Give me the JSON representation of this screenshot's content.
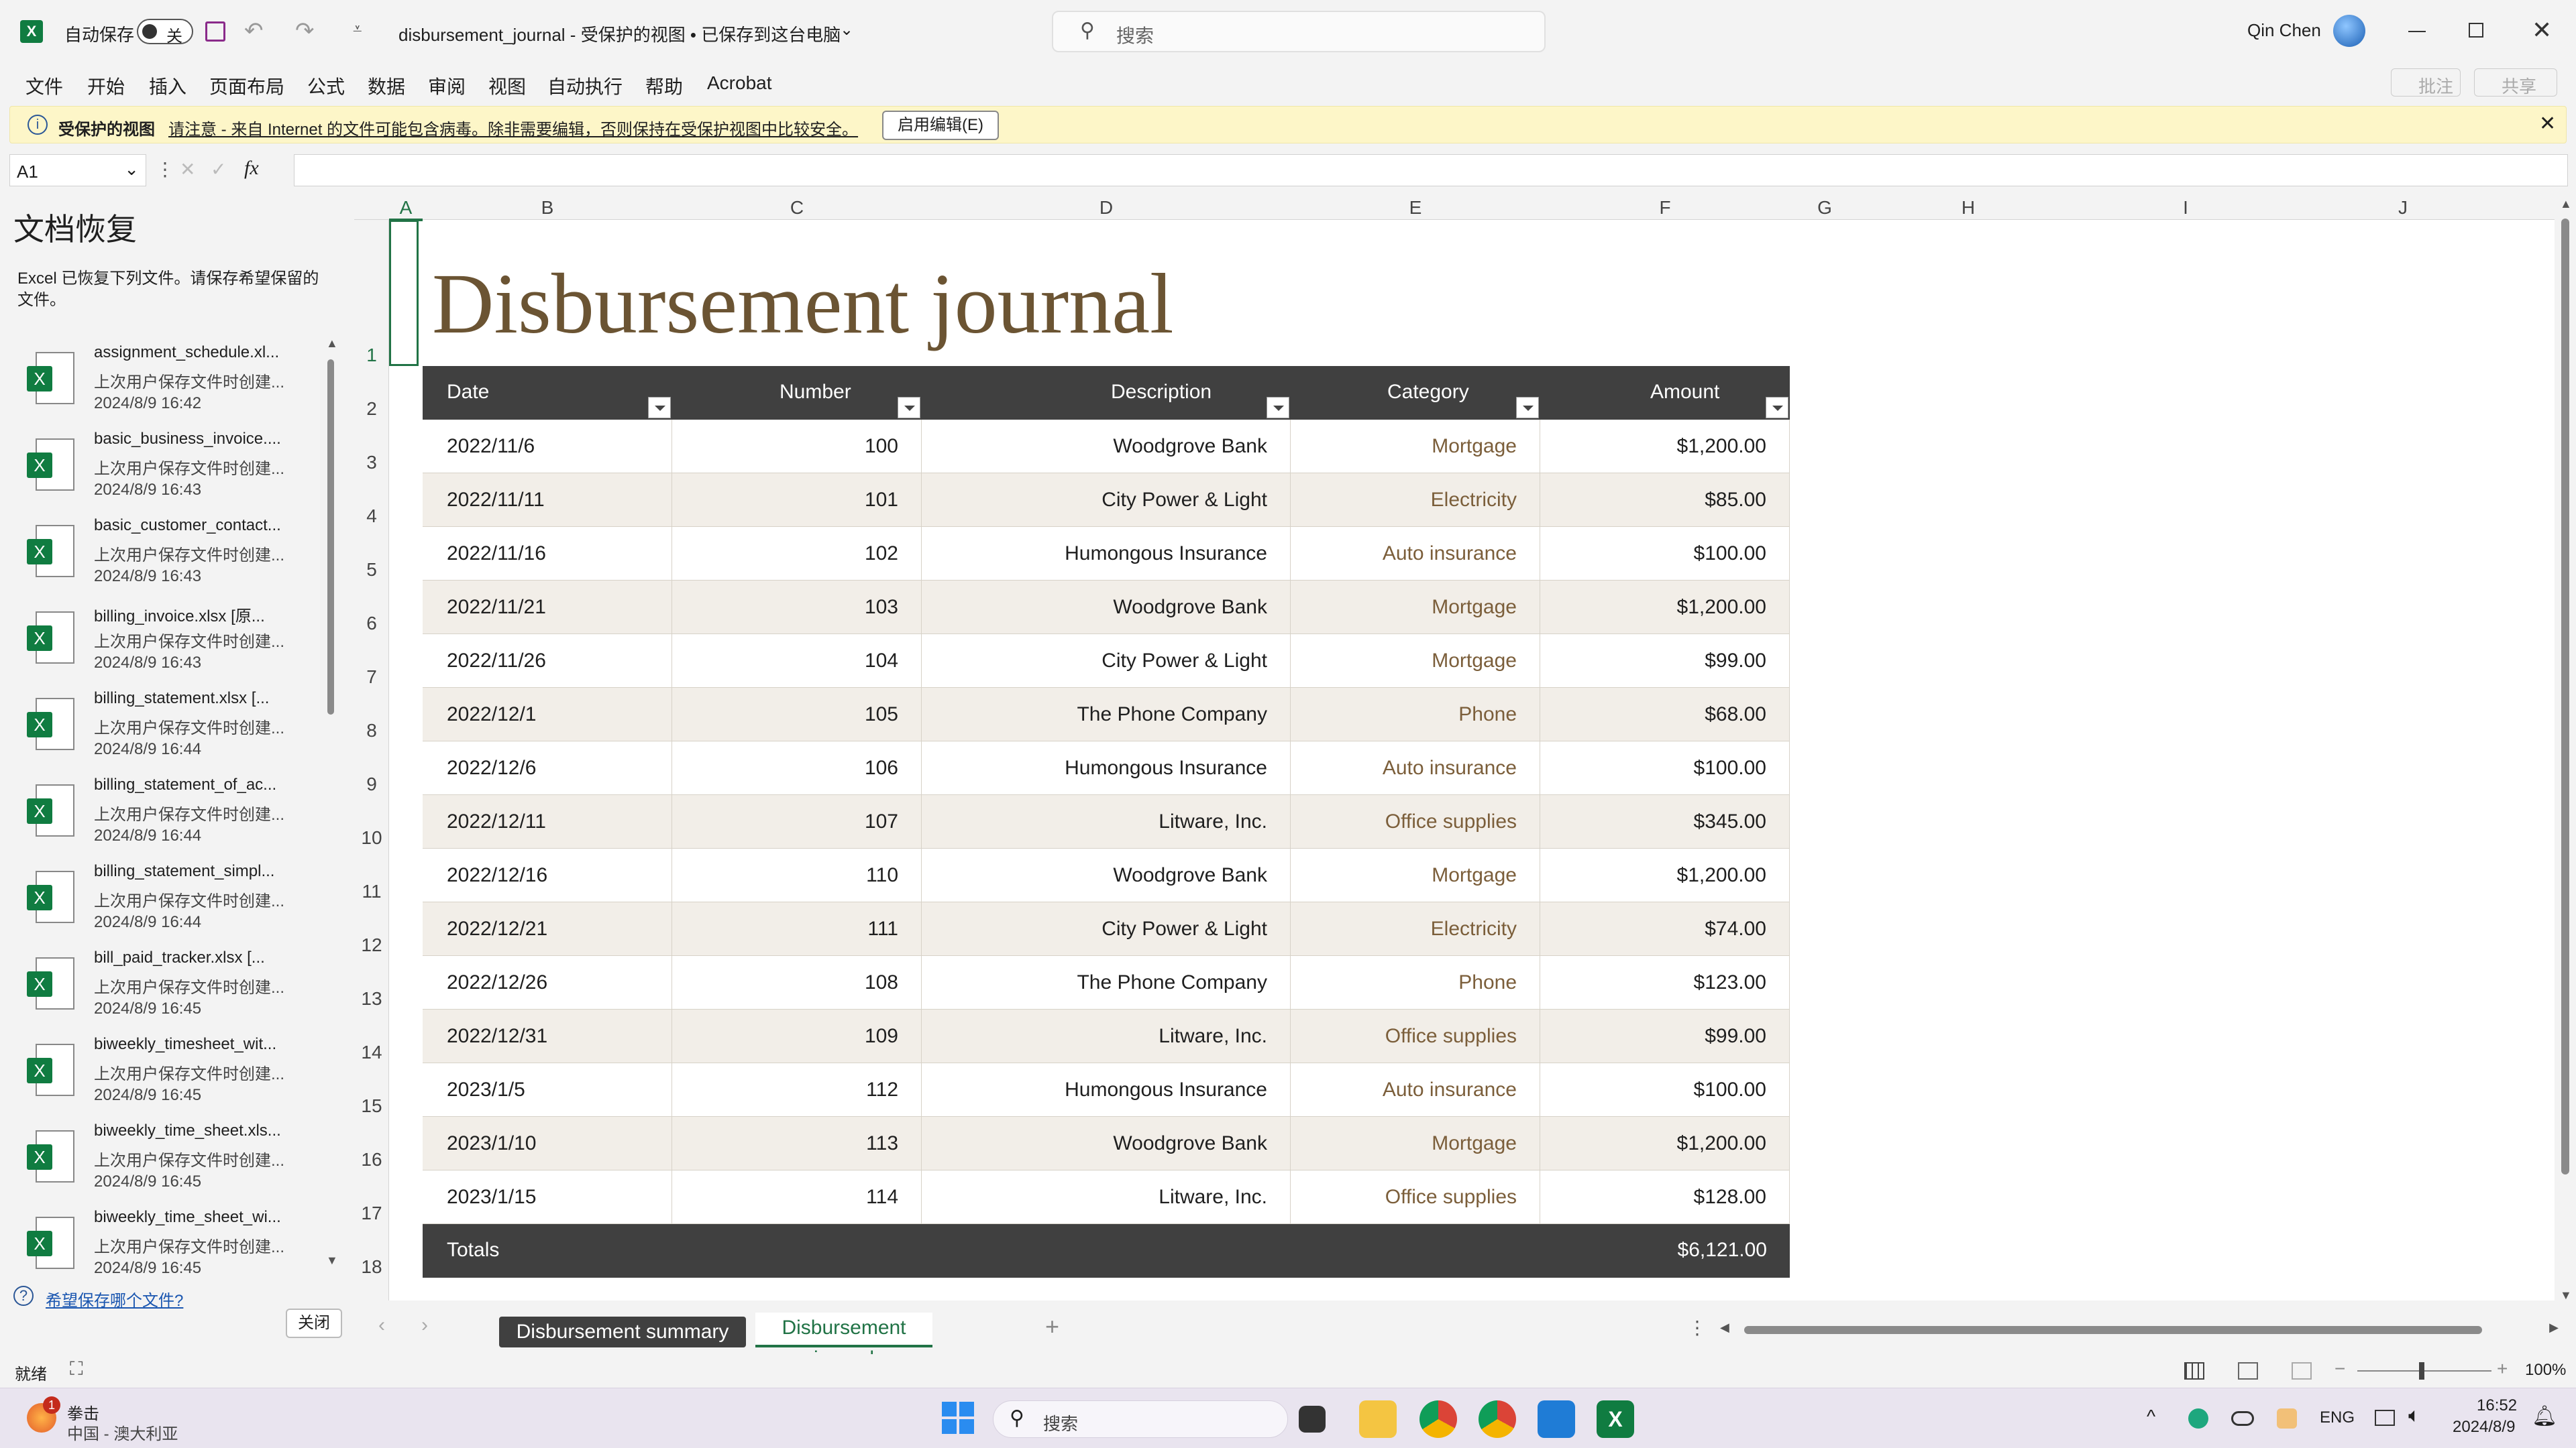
{
  "titlebar": {
    "autosave_label": "自动保存",
    "autosave_state": "关",
    "file_title": "disbursement_journal  -  受保护的视图 • 已保存到这台电脑",
    "search_placeholder": "搜索",
    "user_name": "Qin Chen"
  },
  "menu": [
    "文件",
    "开始",
    "插入",
    "页面布局",
    "公式",
    "数据",
    "审阅",
    "视图",
    "自动执行",
    "帮助",
    "Acrobat"
  ],
  "menu_right": {
    "comments": "批注",
    "share": "共享"
  },
  "infobar": {
    "title": "受保护的视图",
    "message": "请注意 - 来自 Internet 的文件可能包含病毒。除非需要编辑，否则保持在受保护视图中比较安全。",
    "button": "启用编辑(E)"
  },
  "formula": {
    "namebox": "A1",
    "fx": "fx",
    "value": ""
  },
  "recovery": {
    "title": "文档恢复",
    "desc": "Excel 已恢复下列文件。请保存希望保留的文件。",
    "items": [
      {
        "name": "assignment_schedule.xl...",
        "sub": "上次用户保存文件时创建...",
        "date": "2024/8/9 16:42"
      },
      {
        "name": "basic_business_invoice....",
        "sub": "上次用户保存文件时创建...",
        "date": "2024/8/9 16:43"
      },
      {
        "name": "basic_customer_contact...",
        "sub": "上次用户保存文件时创建...",
        "date": "2024/8/9 16:43"
      },
      {
        "name": "billing_invoice.xlsx  [原...",
        "sub": "上次用户保存文件时创建...",
        "date": "2024/8/9 16:43"
      },
      {
        "name": "billing_statement.xlsx  [...",
        "sub": "上次用户保存文件时创建...",
        "date": "2024/8/9 16:44"
      },
      {
        "name": "billing_statement_of_ac...",
        "sub": "上次用户保存文件时创建...",
        "date": "2024/8/9 16:44"
      },
      {
        "name": "billing_statement_simpl...",
        "sub": "上次用户保存文件时创建...",
        "date": "2024/8/9 16:44"
      },
      {
        "name": "bill_paid_tracker.xlsx  [...",
        "sub": "上次用户保存文件时创建...",
        "date": "2024/8/9 16:45"
      },
      {
        "name": "biweekly_timesheet_wit...",
        "sub": "上次用户保存文件时创建...",
        "date": "2024/8/9 16:45"
      },
      {
        "name": "biweekly_time_sheet.xls...",
        "sub": "上次用户保存文件时创建...",
        "date": "2024/8/9 16:45"
      },
      {
        "name": "biweekly_time_sheet_wi...",
        "sub": "上次用户保存文件时创建...",
        "date": "2024/8/9 16:45"
      }
    ],
    "which_link": "希望保存哪个文件?",
    "close_button": "关闭"
  },
  "sheet": {
    "columns": [
      "A",
      "B",
      "C",
      "D",
      "E",
      "F",
      "G",
      "H",
      "I",
      "J"
    ],
    "rows": [
      "1",
      "2",
      "3",
      "4",
      "5",
      "6",
      "7",
      "8",
      "9",
      "10",
      "11",
      "12",
      "13",
      "14",
      "15",
      "16",
      "17",
      "18"
    ],
    "title": "Disbursement journal",
    "headers": [
      "Date",
      "Number",
      "Description",
      "Category",
      "Amount"
    ],
    "data": [
      [
        "2022/11/6",
        "100",
        "Woodgrove Bank",
        "Mortgage",
        "$1,200.00"
      ],
      [
        "2022/11/11",
        "101",
        "City Power & Light",
        "Electricity",
        "$85.00"
      ],
      [
        "2022/11/16",
        "102",
        "Humongous Insurance",
        "Auto insurance",
        "$100.00"
      ],
      [
        "2022/11/21",
        "103",
        "Woodgrove Bank",
        "Mortgage",
        "$1,200.00"
      ],
      [
        "2022/11/26",
        "104",
        "City Power & Light",
        "Mortgage",
        "$99.00"
      ],
      [
        "2022/12/1",
        "105",
        "The Phone Company",
        "Phone",
        "$68.00"
      ],
      [
        "2022/12/6",
        "106",
        "Humongous Insurance",
        "Auto insurance",
        "$100.00"
      ],
      [
        "2022/12/11",
        "107",
        "Litware, Inc.",
        "Office supplies",
        "$345.00"
      ],
      [
        "2022/12/16",
        "110",
        "Woodgrove Bank",
        "Mortgage",
        "$1,200.00"
      ],
      [
        "2022/12/21",
        "111",
        "City Power & Light",
        "Electricity",
        "$74.00"
      ],
      [
        "2022/12/26",
        "108",
        "The Phone Company",
        "Phone",
        "$123.00"
      ],
      [
        "2022/12/31",
        "109",
        "Litware, Inc.",
        "Office supplies",
        "$99.00"
      ],
      [
        "2023/1/5",
        "112",
        "Humongous Insurance",
        "Auto insurance",
        "$100.00"
      ],
      [
        "2023/1/10",
        "113",
        "Woodgrove Bank",
        "Mortgage",
        "$1,200.00"
      ],
      [
        "2023/1/15",
        "114",
        "Litware, Inc.",
        "Office supplies",
        "$128.00"
      ]
    ],
    "totals_label": "Totals",
    "totals_value": "$6,121.00"
  },
  "tabs": {
    "items": [
      "Disbursement summary",
      "Disbursement journal"
    ],
    "active": 1,
    "add": "+"
  },
  "status": {
    "ready": "就绪",
    "zoom": "100%"
  },
  "taskbar": {
    "weather_title": "拳击",
    "weather_sub": "中国 - 澳大利亚",
    "weather_badge": "1",
    "search": "搜索",
    "lang": "ENG",
    "time": "16:52",
    "date": "2024/8/9"
  },
  "colors": {
    "accent_title": "#6b5433",
    "header_bg": "#404040",
    "band": "#f2eee8",
    "category_text": "#7b5e3a",
    "excel_green": "#107c41"
  }
}
